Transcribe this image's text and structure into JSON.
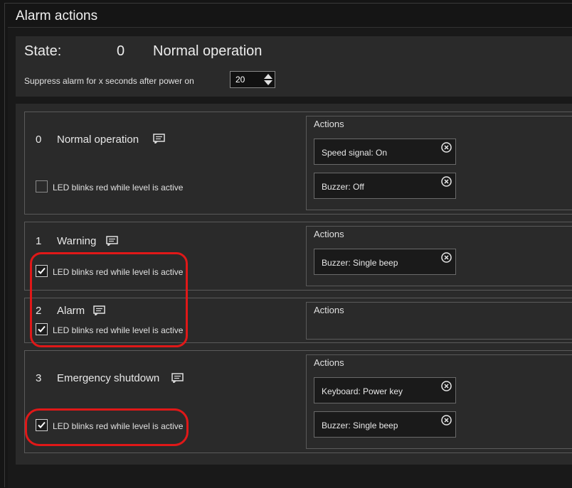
{
  "window": {
    "title": "Alarm actions"
  },
  "state": {
    "label": "State:",
    "number": "0",
    "name": "Normal operation"
  },
  "suppress": {
    "label": "Suppress alarm for x seconds after power on",
    "value": "20"
  },
  "common": {
    "actions_title": "Actions",
    "led_label": "LED blinks red while level is active"
  },
  "levels": [
    {
      "number": "0",
      "name": "Normal operation",
      "led_checked": false,
      "actions": [
        "Speed signal: On",
        "Buzzer: Off"
      ]
    },
    {
      "number": "1",
      "name": "Warning",
      "led_checked": true,
      "actions": [
        "Buzzer: Single beep"
      ]
    },
    {
      "number": "2",
      "name": "Alarm",
      "led_checked": true,
      "actions": []
    },
    {
      "number": "3",
      "name": "Emergency shutdown",
      "led_checked": true,
      "actions": [
        "Keyboard: Power key",
        "Buzzer: Single beep"
      ]
    }
  ],
  "colors": {
    "highlight": "#e01818",
    "panel": "#2a2a2a",
    "background": "#151515"
  }
}
